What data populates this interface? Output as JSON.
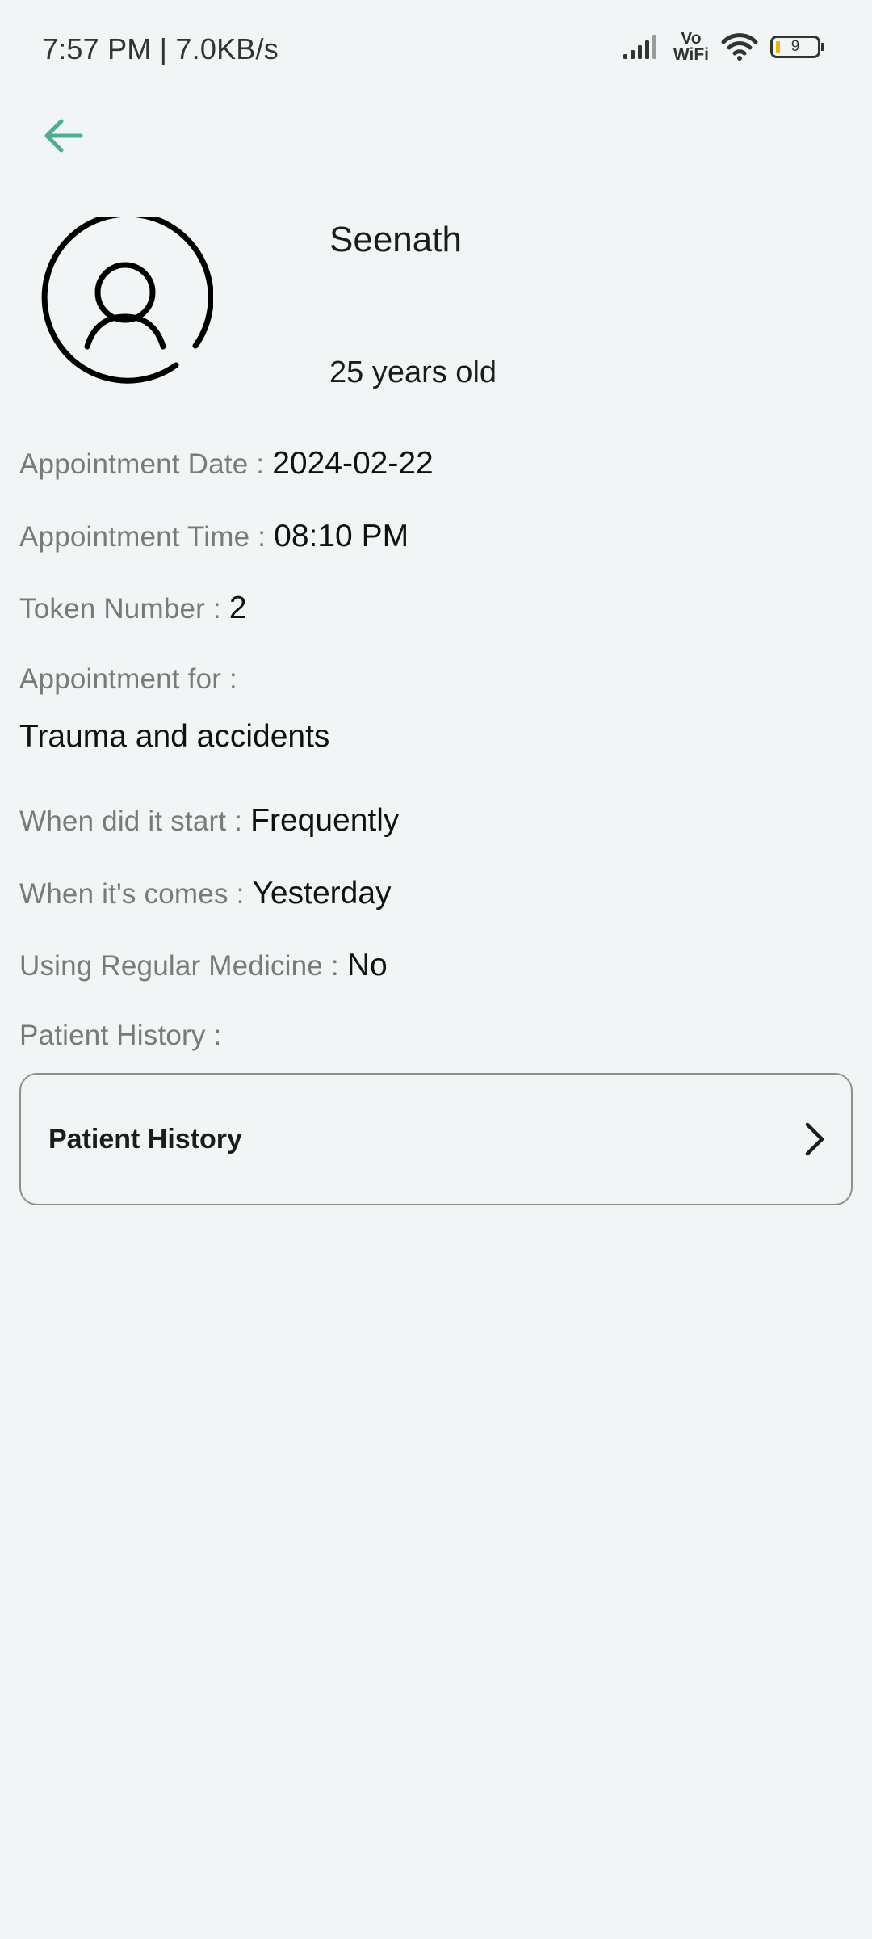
{
  "status_bar": {
    "time": "7:57 PM | 7.0KB/s",
    "vowifi_top": "Vo",
    "vowifi_bottom": "WiFi",
    "battery": "9",
    "battery_accent": "#f0b400"
  },
  "header": {
    "back_icon": "arrow-left-icon",
    "accent_color": "#4caf93"
  },
  "patient": {
    "avatar_icon": "user-icon",
    "name": "Seenath",
    "age": "25 years old"
  },
  "details": {
    "appointment_date": {
      "label": "Appointment Date :",
      "value": "2024-02-22"
    },
    "appointment_time": {
      "label": "Appointment Time :",
      "value": "08:10 PM"
    },
    "token_number": {
      "label": "Token Number :",
      "value": "2"
    },
    "appointment_for": {
      "label": "Appointment for :",
      "value": "Trauma and accidents"
    },
    "start": {
      "label": "When did it start :",
      "value": "Frequently"
    },
    "comes": {
      "label": "When it's comes :",
      "value": "Yesterday"
    },
    "regular_medicine": {
      "label": "Using Regular Medicine :",
      "value": "No"
    },
    "patient_history": {
      "label": "Patient History :"
    }
  },
  "history_card": {
    "label": "Patient History",
    "chevron_icon": "chevron-right-icon"
  }
}
